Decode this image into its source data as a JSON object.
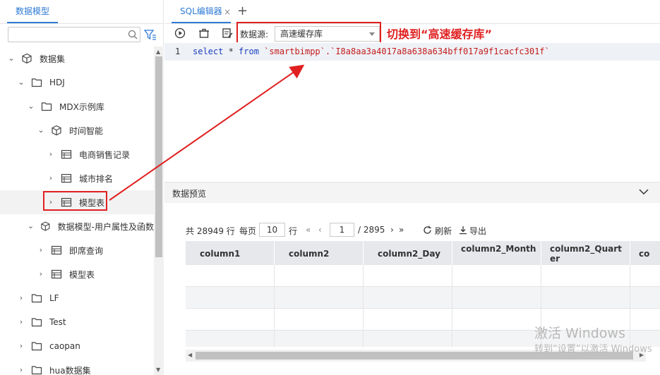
{
  "left": {
    "tab_label": "数据模型",
    "search_placeholder": "",
    "tree": [
      {
        "label": "数据集",
        "icon": "cube-icon"
      },
      {
        "label": "HDJ",
        "icon": "folder-icon"
      },
      {
        "label": "MDX示例库",
        "icon": "folder-icon"
      },
      {
        "label": "时间智能",
        "icon": "cube-icon"
      },
      {
        "label": "电商销售记录",
        "icon": "table-icon"
      },
      {
        "label": "城市排名",
        "icon": "table-icon"
      },
      {
        "label": "模型表",
        "icon": "table-icon"
      },
      {
        "label": "数据模型-用户属性及函数",
        "icon": "cube-icon"
      },
      {
        "label": "即席查询",
        "icon": "table-icon"
      },
      {
        "label": "模型表",
        "icon": "table-icon"
      },
      {
        "label": "LF",
        "icon": "folder-icon"
      },
      {
        "label": "Test",
        "icon": "folder-icon"
      },
      {
        "label": "caopan",
        "icon": "folder-icon"
      },
      {
        "label": "hua数据集",
        "icon": "folder-icon"
      }
    ]
  },
  "tabs": {
    "sql_tab": "SQL编辑器",
    "close": "×",
    "add": "+"
  },
  "toolbar": {
    "datasource_label": "数据源:",
    "datasource_value": "高速缓存库"
  },
  "annotation": {
    "text": "切换到“高速缓存库”"
  },
  "editor": {
    "line_number": "1",
    "kw_select": "select",
    "star": " * ",
    "kw_from": "from",
    "table_ref": " `smartbimpp`.`I8a8aa3a4017a8a638a634bff017a9f1cacfc301f`"
  },
  "preview": {
    "title": "数据预览",
    "pager": {
      "total_prefix": "共 28949 行",
      "per_page_label": "每页",
      "per_page_value": "10",
      "per_page_suffix": "行",
      "first": "«",
      "prev": "‹",
      "page_value": "1",
      "total_pages": "/ 2895",
      "next": "›",
      "last": "»",
      "refresh": "刷新",
      "export": "导出"
    },
    "columns": [
      "column1",
      "column2",
      "column2_Day",
      "column2_Month",
      "column2_Quarter",
      "co"
    ]
  },
  "watermark": {
    "line1": "激活 Windows",
    "line2": "转到“设置”以激活 Windows"
  },
  "colors": {
    "accent": "#2f7bd6",
    "highlight_red": "#e02020"
  }
}
